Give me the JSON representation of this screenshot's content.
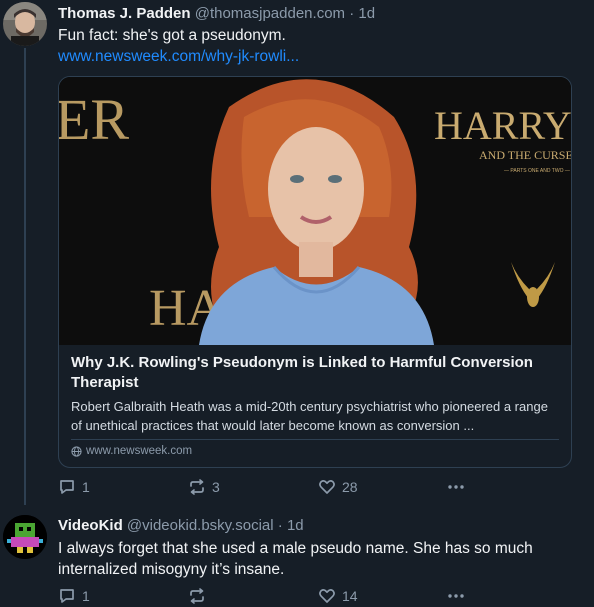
{
  "posts": [
    {
      "author_name": "Thomas J. Padden",
      "handle": "@thomasjpadden.com",
      "separator": "·",
      "time": "1d",
      "text": "Fun fact: she's got a pseudonym.",
      "link_text": "www.newsweek.com/why-jk-rowli...",
      "embed": {
        "title": "Why J.K. Rowling's Pseudonym is Linked to Harmful Conversion Therapist",
        "description": "Robert Galbraith Heath was a mid-20th century psychiatrist who pioneered a range of unethical practices that would later become known as conversion ...",
        "domain": "www.newsweek.com",
        "image_text": {
          "left_top": "ER",
          "left_bottom": "HA",
          "right_title": "HARRY POT",
          "right_subtitle": "AND THE CURSED CHI",
          "right_small": "— PARTS ONE AND TWO —"
        }
      },
      "counts": {
        "replies": "1",
        "reposts": "3",
        "likes": "28"
      }
    },
    {
      "author_name": "VideoKid",
      "handle": "@videokid.bsky.social",
      "separator": "·",
      "time": "1d",
      "text": "I always forget that she used a male pseudo name. She has so much internalized misogyny it’s insane.",
      "counts": {
        "replies": "1",
        "reposts": "",
        "likes": "14"
      }
    }
  ],
  "colors": {
    "background": "#161e27",
    "muted": "#8c9bab",
    "link": "#208bfe",
    "border": "#2e4052"
  },
  "icons": [
    "reply-icon",
    "repost-icon",
    "like-icon",
    "more-icon",
    "globe-icon"
  ]
}
